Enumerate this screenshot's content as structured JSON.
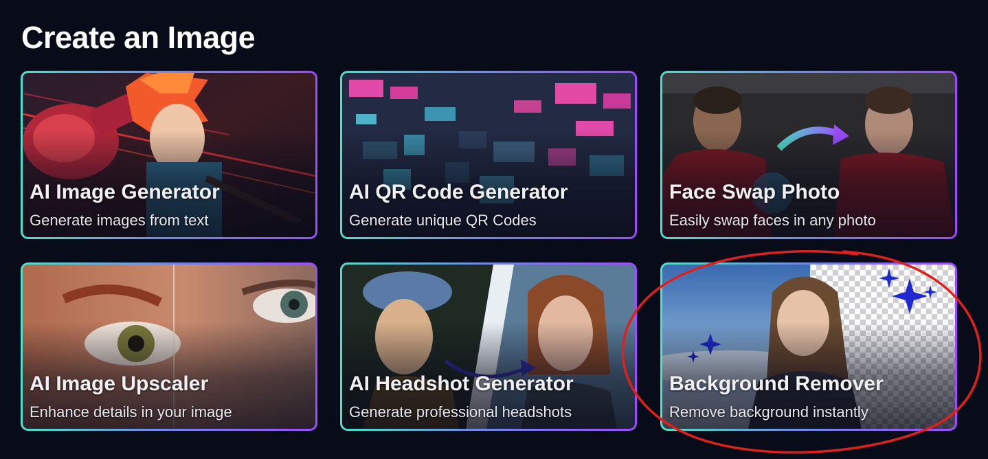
{
  "page": {
    "title": "Create an Image"
  },
  "cards": [
    {
      "title": "AI Image Generator",
      "subtitle": "Generate images from text"
    },
    {
      "title": "AI QR Code Generator",
      "subtitle": "Generate unique QR Codes"
    },
    {
      "title": "Face Swap Photo",
      "subtitle": "Easily swap faces in any photo"
    },
    {
      "title": "AI Image Upscaler",
      "subtitle": "Enhance details in your image"
    },
    {
      "title": "AI Headshot Generator",
      "subtitle": "Generate professional headshots"
    },
    {
      "title": "Background Remover",
      "subtitle": "Remove background instantly"
    }
  ],
  "colors": {
    "background": "#080b18",
    "border_start": "#4fe0c8",
    "border_end": "#9b4dfa",
    "annotation": "#e0201c"
  }
}
